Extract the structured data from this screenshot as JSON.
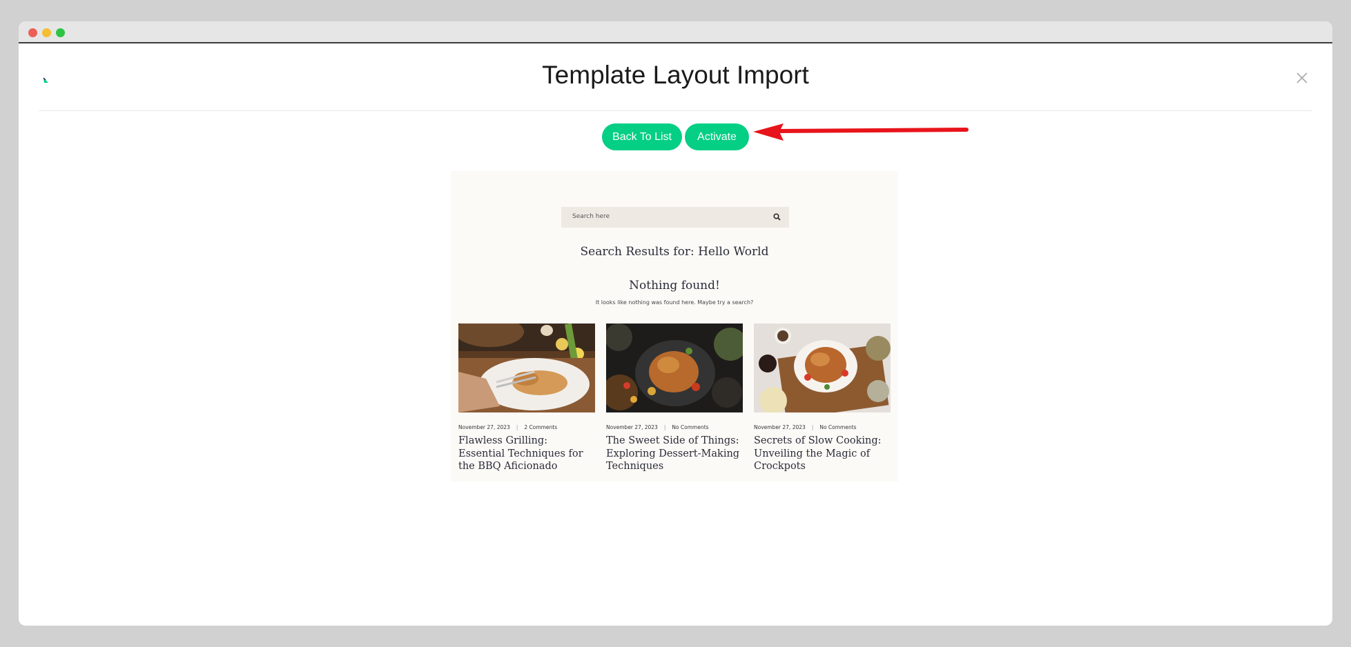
{
  "window": {
    "controls": [
      "close",
      "minimize",
      "maximize"
    ]
  },
  "modal": {
    "title": "Template Layout Import",
    "logo_icon": "brand-logo-icon",
    "close_icon": "close-icon",
    "buttons": {
      "back": "Back To List",
      "activate": "Activate"
    },
    "accent_color": "#04cf84",
    "annotation_color": "#e8141b"
  },
  "preview": {
    "search_placeholder": "Search here",
    "results_title": "Search Results for: Hello World",
    "nothing_title": "Nothing found!",
    "nothing_sub": "It looks like nothing was found here. Maybe try a search?",
    "posts": [
      {
        "date": "November 27, 2023",
        "comments": "2 Comments",
        "title": "Flawless Grilling: Essential Techniques for the BBQ Aficionado"
      },
      {
        "date": "November 27, 2023",
        "comments": "No Comments",
        "title": "The Sweet Side of Things: Exploring Dessert-Making Techniques"
      },
      {
        "date": "November 27, 2023",
        "comments": "No Comments",
        "title": "Secrets of Slow Cooking: Unveiling the Magic of Crockpots"
      }
    ]
  }
}
